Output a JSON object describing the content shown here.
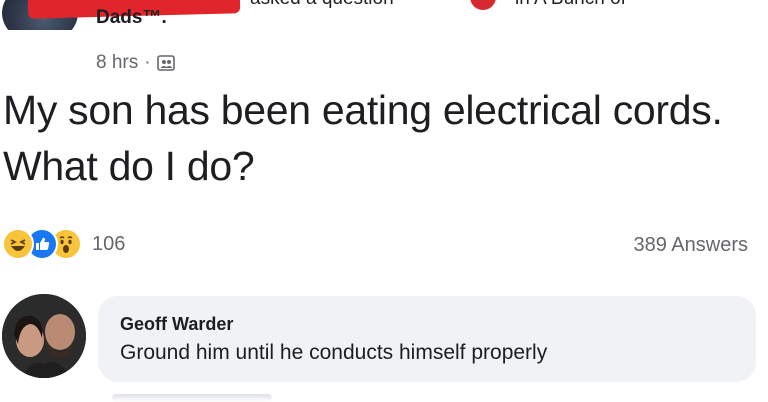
{
  "header": {
    "fragment_left": "asked a question",
    "fragment_right": "in A Bunch of",
    "group_name": "Dads™."
  },
  "post": {
    "time": "8 hrs",
    "separator": "·",
    "audience_icon": "group-audience-icon",
    "text": "My son has been eating electrical cords. What do I do?"
  },
  "stats": {
    "reactions": [
      "haha-icon",
      "like-icon",
      "wow-icon"
    ],
    "reaction_count": "106",
    "answers": "389 Answers"
  },
  "comment": {
    "author": "Geoff Warder",
    "text": "Ground him until he conducts himself properly"
  },
  "colors": {
    "like_blue": "#1877f2",
    "bubble_bg": "#f0f2f5",
    "meta_gray": "#65676b",
    "redaction_red": "#e0262c"
  }
}
